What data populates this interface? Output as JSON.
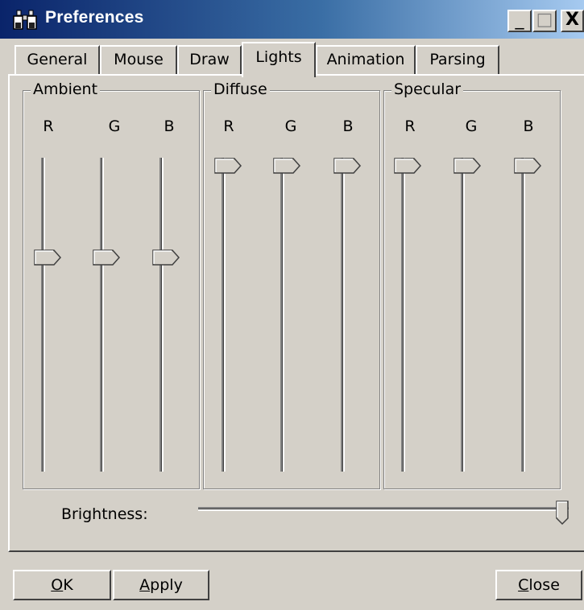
{
  "window": {
    "title": "Preferences",
    "icon": "binoculars-icon"
  },
  "titlebar_buttons": {
    "minimize": "_",
    "maximize": "□",
    "close": "X"
  },
  "tabs": [
    {
      "label": "General"
    },
    {
      "label": "Mouse"
    },
    {
      "label": "Draw"
    },
    {
      "label": "Lights",
      "active": true
    },
    {
      "label": "Animation"
    },
    {
      "label": "Parsing"
    }
  ],
  "groups": {
    "ambient": {
      "label": "Ambient",
      "channels": {
        "r": "R",
        "g": "G",
        "b": "B"
      }
    },
    "diffuse": {
      "label": "Diffuse",
      "channels": {
        "r": "R",
        "g": "G",
        "b": "B"
      }
    },
    "specular": {
      "label": "Specular",
      "channels": {
        "r": "R",
        "g": "G",
        "b": "B"
      }
    }
  },
  "slider_levels": {
    "ambient": {
      "r": 0.7,
      "g": 0.7,
      "b": 0.7
    },
    "diffuse": {
      "r": 1.0,
      "g": 1.0,
      "b": 1.0
    },
    "specular": {
      "r": 1.0,
      "g": 1.0,
      "b": 1.0
    },
    "brightness": 1.0
  },
  "brightness": {
    "label": "Brightness:"
  },
  "buttons": {
    "ok": {
      "mnemonic": "O",
      "rest": "K"
    },
    "apply": {
      "mnemonic": "A",
      "rest": "pply"
    },
    "close": {
      "mnemonic": "C",
      "rest": "lose"
    }
  },
  "colors": {
    "face": "#d4d0c8",
    "titlebar_start": "#0a246a",
    "titlebar_end": "#a6caf0"
  }
}
